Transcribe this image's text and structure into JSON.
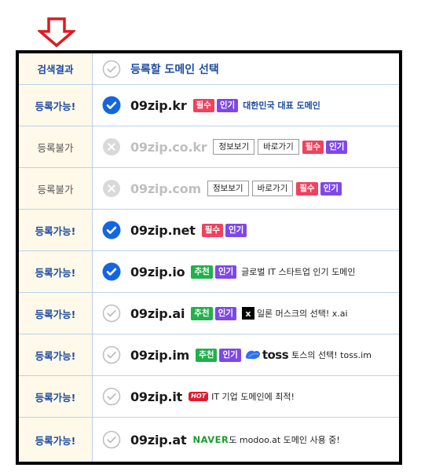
{
  "header": {
    "status_label": "검색결과",
    "title": "등록할 도메인 선택"
  },
  "rows": [
    {
      "status": "등록가능!",
      "domain": "09zip.kr",
      "badges": [
        "필수",
        "인기"
      ],
      "desc": "대한민국 대표 도메인"
    },
    {
      "status": "등록불가",
      "domain": "09zip.co.kr",
      "buttons": [
        "정보보기",
        "바로가기"
      ],
      "badges": [
        "필수",
        "인기"
      ]
    },
    {
      "status": "등록불가",
      "domain": "09zip.com",
      "buttons": [
        "정보보기",
        "바로가기"
      ],
      "badges": [
        "필수",
        "인기"
      ]
    },
    {
      "status": "등록가능!",
      "domain": "09zip.net",
      "badges": [
        "필수",
        "인기"
      ]
    },
    {
      "status": "등록가능!",
      "domain": "09zip.io",
      "badges": [
        "추천",
        "인기"
      ],
      "desc": "글로벌 IT 스타트업 인기 도메인"
    },
    {
      "status": "등록가능!",
      "domain": "09zip.ai",
      "badges": [
        "추천",
        "인기"
      ],
      "logo_text": "x",
      "desc": "일론 머스크의 선택! x.ai"
    },
    {
      "status": "등록가능!",
      "domain": "09zip.im",
      "badges": [
        "추천",
        "인기"
      ],
      "logo_text": "toss",
      "desc": "토스의 선택! toss.im"
    },
    {
      "status": "등록가능!",
      "domain": "09zip.it",
      "hot": "HOT",
      "desc": "IT 기업 도메인에 최적!"
    },
    {
      "status": "등록가능!",
      "domain": "09zip.at",
      "naver": "NAVER",
      "desc": "도 modoo.at 도메인 사용 중!"
    }
  ],
  "colors": {
    "accent": "#1f4da0",
    "check_selected": "#1565e0",
    "badge_required": "#f0415d",
    "badge_popular": "#7e48e6",
    "badge_recommended": "#21b04b",
    "status_bg": "#fff9ea",
    "row_border": "#b9d3ea",
    "down_arrow": "#e0191f"
  },
  "icons": {
    "pointer": "down-arrow-icon",
    "selected": "check-circle-filled-icon",
    "unselected": "check-circle-outline-icon",
    "unavailable": "x-circle-icon"
  }
}
